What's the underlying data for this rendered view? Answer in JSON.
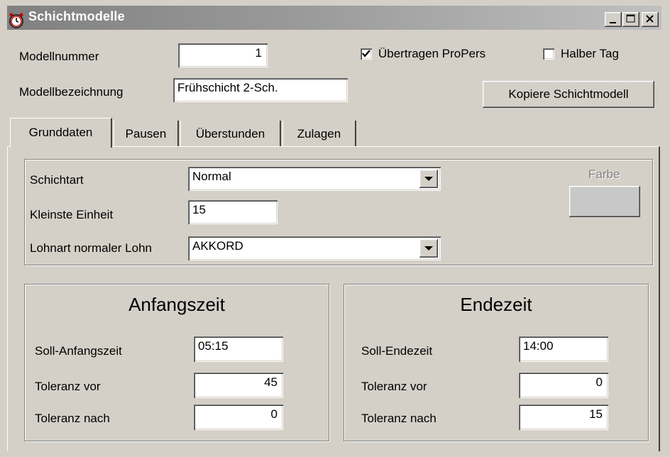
{
  "window": {
    "title": "Schichtmodelle",
    "icon": "clock-icon"
  },
  "header": {
    "modellnummer_label": "Modellnummer",
    "modellnummer_value": "1",
    "bezeichnung_label": "Modellbezeichnung",
    "bezeichnung_value": "Frühschicht 2-Sch.",
    "uebertragen_label": "Übertragen ProPers",
    "uebertragen_checked": true,
    "halber_tag_label": "Halber Tag",
    "halber_tag_checked": false,
    "kopiere_button": "Kopiere Schichtmodell"
  },
  "tabs": [
    {
      "label": "Grunddaten",
      "active": true
    },
    {
      "label": "Pausen",
      "active": false
    },
    {
      "label": "Überstunden",
      "active": false
    },
    {
      "label": "Zulagen",
      "active": false
    }
  ],
  "grunddaten": {
    "schichtart_label": "Schichtart",
    "schichtart_value": "Normal",
    "kleinste_einheit_label": "Kleinste Einheit",
    "kleinste_einheit_value": "15",
    "lohnart_label": "Lohnart normaler Lohn",
    "lohnart_value": "AKKORD",
    "farbe_label": "Farbe"
  },
  "anfangszeit": {
    "title": "Anfangszeit",
    "soll_label": "Soll-Anfangszeit",
    "soll_value": "05:15",
    "tol_vor_label": "Toleranz vor",
    "tol_vor_value": "45",
    "tol_nach_label": "Toleranz nach",
    "tol_nach_value": "0"
  },
  "endezeit": {
    "title": "Endezeit",
    "soll_label": "Soll-Endezeit",
    "soll_value": "14:00",
    "tol_vor_label": "Toleranz vor",
    "tol_vor_value": "0",
    "tol_nach_label": "Toleranz nach",
    "tol_nach_value": "15"
  }
}
